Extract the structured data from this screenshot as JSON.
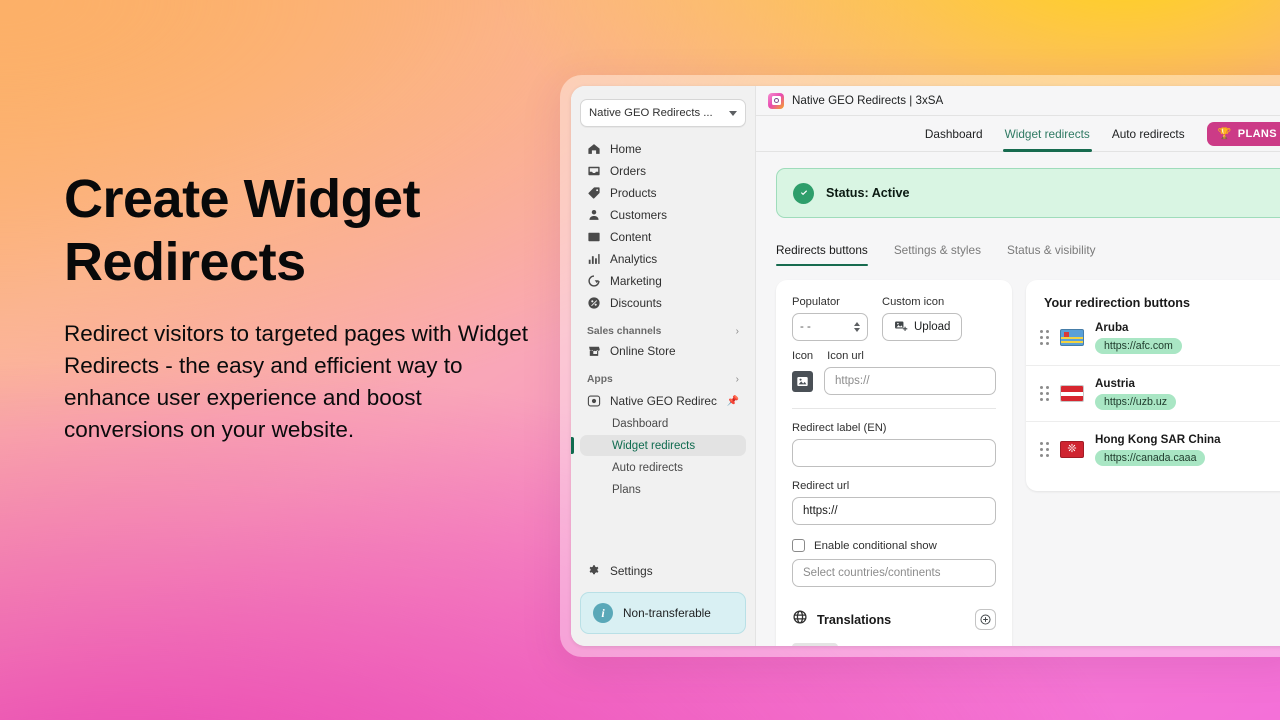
{
  "promo": {
    "headline": "Create Widget Redirects",
    "body": "Redirect visitors to targeted pages with Widget Redirects - the easy and efficient way to enhance user experience and boost conversions on your website."
  },
  "colors": {
    "accent_green": "#176b4f",
    "plans_pink": "#cc3b87",
    "status_bg": "#d9f5e3",
    "info_bg": "#d9f0f3",
    "chip_green": "#a9e6c4"
  },
  "sidebar": {
    "store_picker": {
      "label": "Native GEO Redirects ...",
      "icon": "chevron-down-icon"
    },
    "items": [
      {
        "label": "Home",
        "icon": "home-icon"
      },
      {
        "label": "Orders",
        "icon": "orders-icon"
      },
      {
        "label": "Products",
        "icon": "tag-icon"
      },
      {
        "label": "Customers",
        "icon": "person-icon"
      },
      {
        "label": "Content",
        "icon": "content-icon"
      },
      {
        "label": "Analytics",
        "icon": "bar-chart-icon"
      },
      {
        "label": "Marketing",
        "icon": "megaphone-icon"
      },
      {
        "label": "Discounts",
        "icon": "discount-icon"
      }
    ],
    "sections": [
      {
        "title": "Sales channels",
        "chevron": "›",
        "items": [
          {
            "label": "Online Store",
            "icon": "store-icon"
          }
        ]
      },
      {
        "title": "Apps",
        "chevron": "›",
        "items": []
      }
    ],
    "app": {
      "label": "Native GEO Redirec...",
      "icon": "app-icon",
      "pin": "pin-icon"
    },
    "app_subitems": [
      {
        "label": "Dashboard",
        "active": false
      },
      {
        "label": "Widget redirects",
        "active": true
      },
      {
        "label": "Auto redirects",
        "active": false
      },
      {
        "label": "Plans",
        "active": false
      }
    ],
    "settings": {
      "label": "Settings",
      "icon": "gear-icon"
    },
    "notice": {
      "label": "Non-transferable",
      "icon": "info-icon"
    }
  },
  "appbar": {
    "title": "Native GEO Redirects | 3xSA",
    "icon": "app-logo-icon"
  },
  "tabs": [
    {
      "label": "Dashboard",
      "active": false
    },
    {
      "label": "Widget redirects",
      "active": true
    },
    {
      "label": "Auto redirects",
      "active": false
    }
  ],
  "plans_button": {
    "label": "PLANS",
    "icon": "trophy-icon"
  },
  "status": {
    "text": "Status: Active",
    "icon": "check-circle-icon"
  },
  "subtabs": [
    {
      "label": "Redirects buttons",
      "active": true
    },
    {
      "label": "Settings & styles",
      "active": false
    },
    {
      "label": "Status & visibility",
      "active": false
    }
  ],
  "form": {
    "populator_label": "Populator",
    "populator_value": "- -",
    "custom_icon_label": "Custom icon",
    "upload_label": "Upload",
    "icon_label": "Icon",
    "icon_url_label": "Icon url",
    "icon_url_placeholder": "https://",
    "icon_url_value": "",
    "redirect_label_label": "Redirect label (EN)",
    "redirect_label_value": "",
    "redirect_url_label": "Redirect url",
    "redirect_url_value": "https://",
    "conditional_label": "Enable conditional show",
    "countries_placeholder": "Select countries/continents",
    "countries_value": "",
    "translations_title": "Translations",
    "translations_add": "add-translation-icon"
  },
  "redirection_list": {
    "title": "Your redirection buttons",
    "rows": [
      {
        "country": "Aruba",
        "url": "https://afc.com",
        "flag": "aruba"
      },
      {
        "country": "Austria",
        "url": "https://uzb.uz",
        "flag": "austria"
      },
      {
        "country": "Hong Kong SAR China",
        "url": "https://canada.caaa",
        "flag": "hong-kong"
      }
    ]
  }
}
